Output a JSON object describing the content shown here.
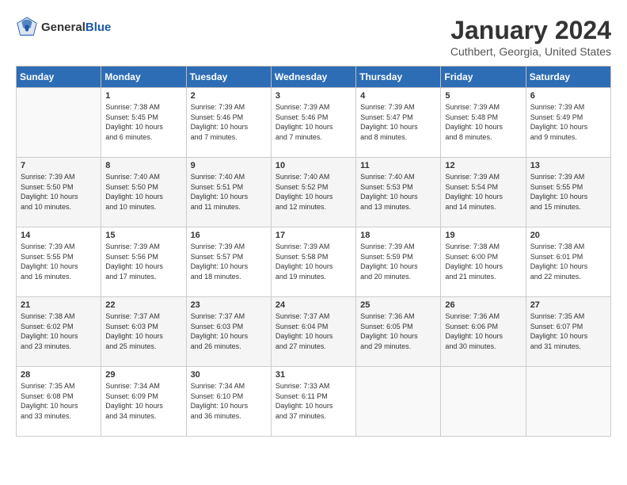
{
  "header": {
    "logo_general": "General",
    "logo_blue": "Blue",
    "month_title": "January 2024",
    "location": "Cuthbert, Georgia, United States"
  },
  "days_of_week": [
    "Sunday",
    "Monday",
    "Tuesday",
    "Wednesday",
    "Thursday",
    "Friday",
    "Saturday"
  ],
  "weeks": [
    [
      {
        "day": "",
        "info": ""
      },
      {
        "day": "1",
        "info": "Sunrise: 7:38 AM\nSunset: 5:45 PM\nDaylight: 10 hours\nand 6 minutes."
      },
      {
        "day": "2",
        "info": "Sunrise: 7:39 AM\nSunset: 5:46 PM\nDaylight: 10 hours\nand 7 minutes."
      },
      {
        "day": "3",
        "info": "Sunrise: 7:39 AM\nSunset: 5:46 PM\nDaylight: 10 hours\nand 7 minutes."
      },
      {
        "day": "4",
        "info": "Sunrise: 7:39 AM\nSunset: 5:47 PM\nDaylight: 10 hours\nand 8 minutes."
      },
      {
        "day": "5",
        "info": "Sunrise: 7:39 AM\nSunset: 5:48 PM\nDaylight: 10 hours\nand 8 minutes."
      },
      {
        "day": "6",
        "info": "Sunrise: 7:39 AM\nSunset: 5:49 PM\nDaylight: 10 hours\nand 9 minutes."
      }
    ],
    [
      {
        "day": "7",
        "info": "Sunrise: 7:39 AM\nSunset: 5:50 PM\nDaylight: 10 hours\nand 10 minutes."
      },
      {
        "day": "8",
        "info": "Sunrise: 7:40 AM\nSunset: 5:50 PM\nDaylight: 10 hours\nand 10 minutes."
      },
      {
        "day": "9",
        "info": "Sunrise: 7:40 AM\nSunset: 5:51 PM\nDaylight: 10 hours\nand 11 minutes."
      },
      {
        "day": "10",
        "info": "Sunrise: 7:40 AM\nSunset: 5:52 PM\nDaylight: 10 hours\nand 12 minutes."
      },
      {
        "day": "11",
        "info": "Sunrise: 7:40 AM\nSunset: 5:53 PM\nDaylight: 10 hours\nand 13 minutes."
      },
      {
        "day": "12",
        "info": "Sunrise: 7:39 AM\nSunset: 5:54 PM\nDaylight: 10 hours\nand 14 minutes."
      },
      {
        "day": "13",
        "info": "Sunrise: 7:39 AM\nSunset: 5:55 PM\nDaylight: 10 hours\nand 15 minutes."
      }
    ],
    [
      {
        "day": "14",
        "info": "Sunrise: 7:39 AM\nSunset: 5:55 PM\nDaylight: 10 hours\nand 16 minutes."
      },
      {
        "day": "15",
        "info": "Sunrise: 7:39 AM\nSunset: 5:56 PM\nDaylight: 10 hours\nand 17 minutes."
      },
      {
        "day": "16",
        "info": "Sunrise: 7:39 AM\nSunset: 5:57 PM\nDaylight: 10 hours\nand 18 minutes."
      },
      {
        "day": "17",
        "info": "Sunrise: 7:39 AM\nSunset: 5:58 PM\nDaylight: 10 hours\nand 19 minutes."
      },
      {
        "day": "18",
        "info": "Sunrise: 7:39 AM\nSunset: 5:59 PM\nDaylight: 10 hours\nand 20 minutes."
      },
      {
        "day": "19",
        "info": "Sunrise: 7:38 AM\nSunset: 6:00 PM\nDaylight: 10 hours\nand 21 minutes."
      },
      {
        "day": "20",
        "info": "Sunrise: 7:38 AM\nSunset: 6:01 PM\nDaylight: 10 hours\nand 22 minutes."
      }
    ],
    [
      {
        "day": "21",
        "info": "Sunrise: 7:38 AM\nSunset: 6:02 PM\nDaylight: 10 hours\nand 23 minutes."
      },
      {
        "day": "22",
        "info": "Sunrise: 7:37 AM\nSunset: 6:03 PM\nDaylight: 10 hours\nand 25 minutes."
      },
      {
        "day": "23",
        "info": "Sunrise: 7:37 AM\nSunset: 6:03 PM\nDaylight: 10 hours\nand 26 minutes."
      },
      {
        "day": "24",
        "info": "Sunrise: 7:37 AM\nSunset: 6:04 PM\nDaylight: 10 hours\nand 27 minutes."
      },
      {
        "day": "25",
        "info": "Sunrise: 7:36 AM\nSunset: 6:05 PM\nDaylight: 10 hours\nand 29 minutes."
      },
      {
        "day": "26",
        "info": "Sunrise: 7:36 AM\nSunset: 6:06 PM\nDaylight: 10 hours\nand 30 minutes."
      },
      {
        "day": "27",
        "info": "Sunrise: 7:35 AM\nSunset: 6:07 PM\nDaylight: 10 hours\nand 31 minutes."
      }
    ],
    [
      {
        "day": "28",
        "info": "Sunrise: 7:35 AM\nSunset: 6:08 PM\nDaylight: 10 hours\nand 33 minutes."
      },
      {
        "day": "29",
        "info": "Sunrise: 7:34 AM\nSunset: 6:09 PM\nDaylight: 10 hours\nand 34 minutes."
      },
      {
        "day": "30",
        "info": "Sunrise: 7:34 AM\nSunset: 6:10 PM\nDaylight: 10 hours\nand 36 minutes."
      },
      {
        "day": "31",
        "info": "Sunrise: 7:33 AM\nSunset: 6:11 PM\nDaylight: 10 hours\nand 37 minutes."
      },
      {
        "day": "",
        "info": ""
      },
      {
        "day": "",
        "info": ""
      },
      {
        "day": "",
        "info": ""
      }
    ]
  ]
}
